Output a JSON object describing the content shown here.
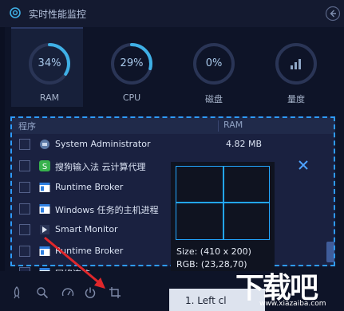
{
  "app": {
    "title": "实时性能监控"
  },
  "metrics": [
    {
      "label": "RAM",
      "value": "34%",
      "percent": 34,
      "active": true
    },
    {
      "label": "CPU",
      "value": "29%",
      "percent": 29,
      "active": false
    },
    {
      "label": "磁盘",
      "value": "0%",
      "percent": 0,
      "active": false
    },
    {
      "label": "量度",
      "value": "",
      "active": false,
      "icon": "bar-chart-icon"
    }
  ],
  "table": {
    "columns": [
      "程序",
      "RAM"
    ],
    "rows": [
      {
        "name": "System Administrator",
        "ram": "4.82 MB",
        "icon": "sysadmin-icon"
      },
      {
        "name": "搜狗输入法 云计算代理",
        "ram": "",
        "icon": "sogou-icon"
      },
      {
        "name": "Runtime Broker",
        "ram": "",
        "icon": "window-app-icon"
      },
      {
        "name": "Windows 任务的主机进程",
        "ram": "",
        "icon": "window-app-icon"
      },
      {
        "name": "Smart Monitor",
        "ram": "",
        "icon": "smart-monitor-icon"
      },
      {
        "name": "Runtime Broker",
        "ram": "",
        "icon": "window-app-icon"
      },
      {
        "name": "网络连接",
        "ram": "",
        "icon": "window-app-icon"
      }
    ]
  },
  "magnifier": {
    "size_text": "Size: (410 x 200)",
    "rgb_text": "RGB: (23,28,70)"
  },
  "bottom": {
    "capture_button_label": "1. Left cl"
  },
  "watermark": {
    "big": "下载吧",
    "small": "www.xiazaiba.com"
  },
  "colors": {
    "accent": "#2f9bff",
    "ring": "#3fb0e6",
    "arrow": "#e0272b",
    "bg": "#0e1428"
  }
}
